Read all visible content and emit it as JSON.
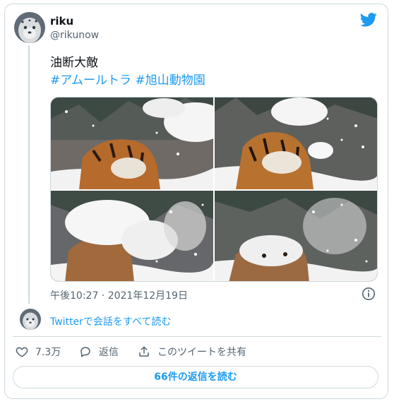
{
  "user": {
    "display_name": "riku",
    "handle": "@rikunow"
  },
  "tweet": {
    "text": "油断大敵",
    "hashtags": [
      "#アムールトラ",
      "#旭山動物園"
    ],
    "timestamp": "午後10:27 · 2021年12月19日"
  },
  "conversation": {
    "read_all_label": "Twitterで会話をすべて読む"
  },
  "actions": {
    "likes_count": "7.3万",
    "reply_label": "返信",
    "share_label": "このツイートを共有"
  },
  "footer": {
    "read_replies_label": "66件の返信を読む"
  },
  "colors": {
    "brand": "#1d9bf0",
    "text": "#0f1419",
    "secondary": "#536471",
    "border": "#cfd9de"
  }
}
